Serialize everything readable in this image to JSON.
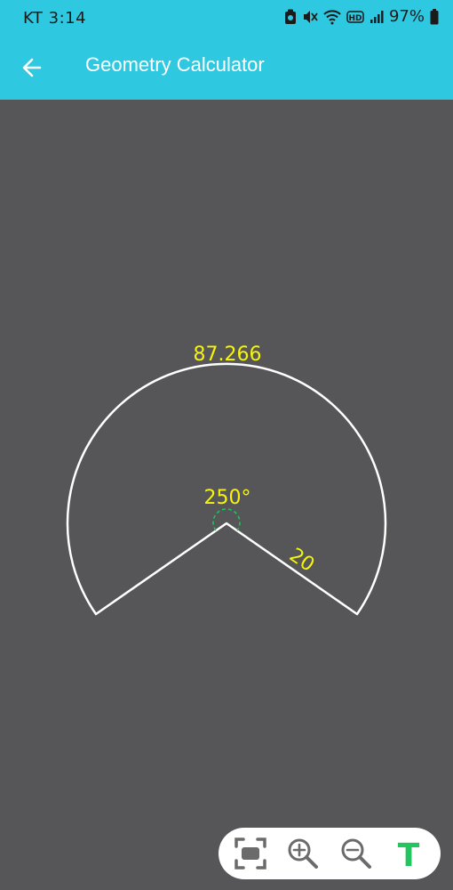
{
  "status_bar": {
    "time": "KT 3:14",
    "battery_percent": "97%",
    "battery_level": 0.97,
    "hd_label": "HD"
  },
  "app_bar": {
    "title": "Geometry Calculator",
    "back_icon": "arrow-left-icon"
  },
  "canvas": {
    "arc_length_label": "87.266",
    "angle_label": "250°",
    "radius_label": "20"
  },
  "toolbar": {
    "items": [
      {
        "name": "fit-screen-button",
        "icon": "fit-screen-icon"
      },
      {
        "name": "zoom-in-button",
        "icon": "zoom-in-icon"
      },
      {
        "name": "zoom-out-button",
        "icon": "zoom-out-icon"
      },
      {
        "name": "text-toggle-button",
        "icon": "text-t-icon",
        "label": "T"
      }
    ]
  },
  "colors": {
    "accent": "#2ec8e0",
    "canvas_bg": "#565557",
    "label": "#f5f50a",
    "angle_arc": "#22c55e",
    "text_toggle": "#22c55e"
  }
}
